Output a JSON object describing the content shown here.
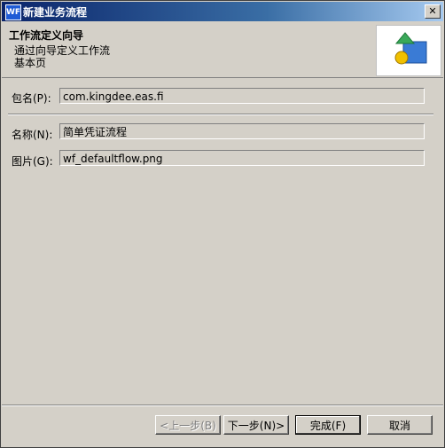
{
  "window": {
    "title": "新建业务流程",
    "icon_text": "WF",
    "close_glyph": "✕"
  },
  "header": {
    "title": "工作流定义向导",
    "desc_line1": "通过向导定义工作流",
    "desc_line2": "基本页",
    "image_icon": "workflow-shapes-icon"
  },
  "form": {
    "package_label": "包名(P):",
    "package_value": "com.kingdee.eas.fi",
    "name_label": "名称(N):",
    "name_value": "简单凭证流程",
    "image_label": "图片(G):",
    "image_value": "wf_defaultflow.png"
  },
  "buttons": {
    "back": "<上一步(B)",
    "next": "下一步(N)>",
    "finish": "完成(F)",
    "cancel": "取消"
  },
  "colors": {
    "title_bar": "#0a246a",
    "face": "#d4d0c8",
    "shape_green": "#3aa95a",
    "shape_yellow": "#f0c000",
    "shape_blue": "#3a7bd5"
  }
}
